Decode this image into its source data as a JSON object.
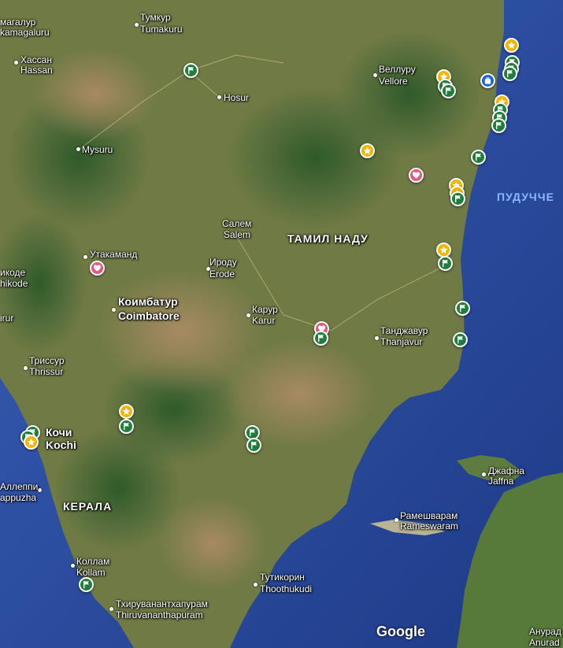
{
  "map": {
    "attribution": "Google",
    "colors": {
      "sea": "#2d4d9e",
      "land": "#6e7a44",
      "flag_pin": "#1e7e3a",
      "star_pin": "#f4b400",
      "heart_pin": "#e8547a",
      "bag_pin": "#1a66d6"
    },
    "labels": {
      "bengaluru_ru": "магалур",
      "bengaluru_en": "kamagaluru",
      "tumkur_ru": "Тумкур",
      "tumkur_en": "Tumakuru",
      "hassan_ru": "Хассан",
      "hassan_en": "Hassan",
      "vellore_ru": "Веллуру",
      "vellore_en": "Vellore",
      "hosur": "Hosur",
      "mysuru": "Mysuru",
      "puducherry": "ПУДУЧЧЕ",
      "salem_ru": "Салем",
      "salem_en": "Salem",
      "tamilnadu": "ТАМИЛ НАДУ",
      "ooty_ru": "Утакаманд",
      "kozhikode_ru": "икоде",
      "kozhikode_en": "hikode",
      "erode_ru": "Ироду",
      "erode_en": "Erode",
      "coimbatore_ru": "Коимбатур",
      "coimbatore_en": "Coimbatore",
      "karur_ru": "Карур",
      "karur_en": "Karur",
      "thanjavur_ru": "Танджавур",
      "thanjavur_en": "Thanjavur",
      "tirur": "irur",
      "thrissur_ru": "Триссур",
      "thrissur_en": "Thrissur",
      "kochi_ru": "Кочи",
      "kochi_en": "Kochi",
      "alleppey_ru": "Аллеппи",
      "alleppey_en": "appuzha",
      "kerala": "КЕРАЛА",
      "jaffna_ru": "Джафна",
      "jaffna_en": "Jaffna",
      "rameswaram_ru": "Рамешварам",
      "rameswaram_en": "Rameswaram",
      "kollam_ru": "Коллам",
      "kollam_en": "Kollam",
      "tuticorin_ru": "Тутикорин",
      "tuticorin_en": "Thoothukudi",
      "trivandrum_ru": "Тхируванантхапурам",
      "trivandrum_en": "Thiruvananthapuram",
      "anuradhapura_ru": "Анурад",
      "anuradhapura_en": "Anurad"
    },
    "pins": [
      {
        "kind": "flag",
        "icon": "flag-icon"
      },
      {
        "kind": "flag",
        "icon": "flag-icon"
      },
      {
        "kind": "flag",
        "icon": "flag-icon"
      },
      {
        "kind": "flag",
        "icon": "flag-icon"
      },
      {
        "kind": "star",
        "icon": "star-icon"
      },
      {
        "kind": "star",
        "icon": "star-icon"
      },
      {
        "kind": "bag",
        "icon": "bag-icon"
      },
      {
        "kind": "star",
        "icon": "star-icon"
      },
      {
        "kind": "flag",
        "icon": "flag-icon"
      },
      {
        "kind": "flag",
        "icon": "flag-icon"
      },
      {
        "kind": "flag",
        "icon": "flag-icon"
      },
      {
        "kind": "flag",
        "icon": "flag-icon"
      },
      {
        "kind": "flag",
        "icon": "flag-icon"
      },
      {
        "kind": "star",
        "icon": "star-icon"
      },
      {
        "kind": "star",
        "icon": "star-icon"
      },
      {
        "kind": "flag",
        "icon": "flag-icon"
      },
      {
        "kind": "heart",
        "icon": "heart-icon"
      },
      {
        "kind": "star",
        "icon": "star-icon"
      },
      {
        "kind": "flag",
        "icon": "flag-icon"
      },
      {
        "kind": "star",
        "icon": "star-icon"
      },
      {
        "kind": "flag",
        "icon": "flag-icon"
      },
      {
        "kind": "heart",
        "icon": "heart-icon"
      },
      {
        "kind": "flag",
        "icon": "flag-icon"
      },
      {
        "kind": "heart",
        "icon": "heart-icon"
      },
      {
        "kind": "flag",
        "icon": "flag-icon"
      },
      {
        "kind": "flag",
        "icon": "flag-icon"
      },
      {
        "kind": "star",
        "icon": "star-icon"
      },
      {
        "kind": "flag",
        "icon": "flag-icon"
      },
      {
        "kind": "flag",
        "icon": "flag-icon"
      },
      {
        "kind": "flag",
        "icon": "flag-icon"
      },
      {
        "kind": "star",
        "icon": "star-icon"
      },
      {
        "kind": "flag",
        "icon": "flag-icon"
      },
      {
        "kind": "flag",
        "icon": "flag-icon"
      },
      {
        "kind": "flag",
        "icon": "flag-icon"
      }
    ]
  }
}
